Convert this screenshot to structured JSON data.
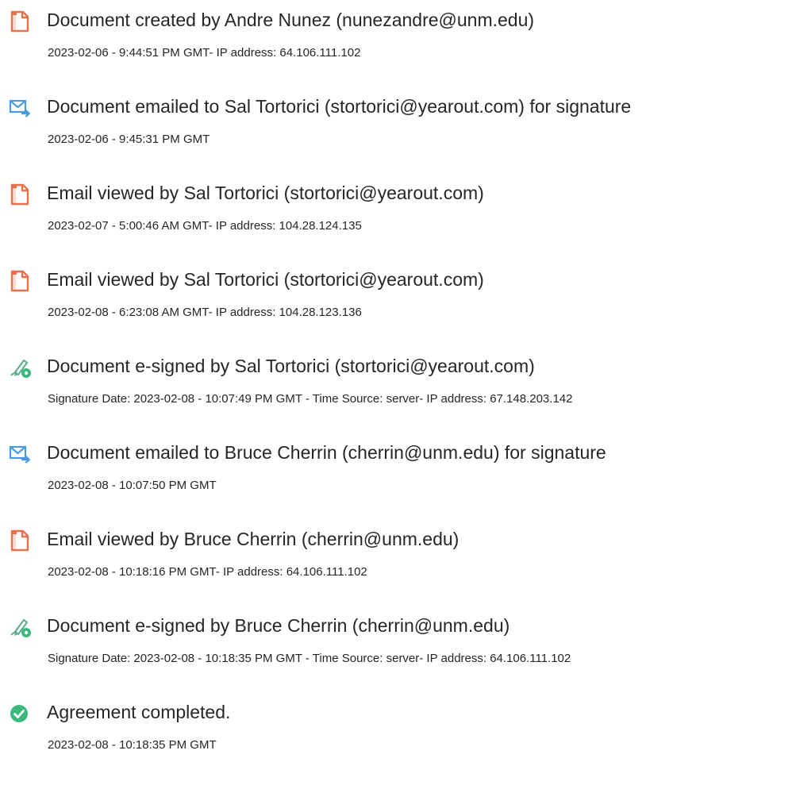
{
  "colors": {
    "pdf_icon": "#e8704b",
    "email_icon": "#4a9ae0",
    "sign_icon_pen": "#60b08a",
    "sign_icon_badge": "#3bb87c",
    "complete_icon": "#3bb87c",
    "text": "#262626"
  },
  "events": [
    {
      "icon": "pdf-document-icon",
      "title": "Document created by Andre Nunez (nunezandre@unm.edu)",
      "detail": "2023-02-06 - 9:44:51 PM GMT- IP address: 64.106.111.102"
    },
    {
      "icon": "email-send-icon",
      "title": "Document emailed to Sal Tortorici (stortorici@yearout.com) for signature",
      "detail": "2023-02-06 - 9:45:31 PM GMT"
    },
    {
      "icon": "pdf-document-icon",
      "title": "Email viewed by Sal Tortorici (stortorici@yearout.com)",
      "detail": "2023-02-07 - 5:00:46 AM GMT- IP address: 104.28.124.135"
    },
    {
      "icon": "pdf-document-icon",
      "title": "Email viewed by Sal Tortorici (stortorici@yearout.com)",
      "detail": "2023-02-08 - 6:23:08 AM GMT- IP address: 104.28.123.136"
    },
    {
      "icon": "esign-pen-icon",
      "title": "Document e-signed by Sal Tortorici (stortorici@yearout.com)",
      "detail": "Signature Date: 2023-02-08 - 10:07:49 PM GMT - Time Source: server- IP address: 67.148.203.142"
    },
    {
      "icon": "email-send-icon",
      "title": "Document emailed to Bruce Cherrin (cherrin@unm.edu) for signature",
      "detail": "2023-02-08 - 10:07:50 PM GMT"
    },
    {
      "icon": "pdf-document-icon",
      "title": "Email viewed by Bruce Cherrin (cherrin@unm.edu)",
      "detail": "2023-02-08 - 10:18:16 PM GMT- IP address: 64.106.111.102"
    },
    {
      "icon": "esign-pen-icon",
      "title": "Document e-signed by Bruce Cherrin (cherrin@unm.edu)",
      "detail": "Signature Date: 2023-02-08 - 10:18:35 PM GMT - Time Source: server- IP address: 64.106.111.102"
    },
    {
      "icon": "check-circle-icon",
      "title": "Agreement completed.",
      "detail": "2023-02-08 - 10:18:35 PM GMT"
    }
  ]
}
